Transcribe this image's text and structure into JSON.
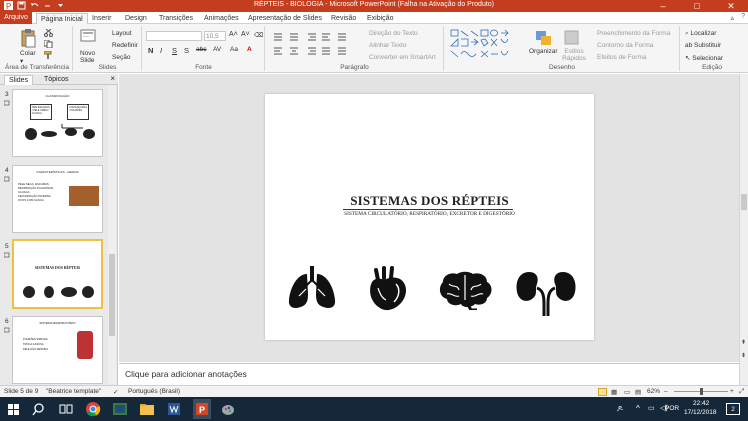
{
  "window": {
    "title": "RÉPTEIS - BIOLOGIA  -  Microsoft PowerPoint (Falha na Ativação do Produto)"
  },
  "ribbon_tabs": [
    "Arquivo",
    "Página Inicial",
    "Inserir",
    "Design",
    "Transições",
    "Animações",
    "Apresentação de Slides",
    "Revisão",
    "Exibição"
  ],
  "ribbon": {
    "clipboard": {
      "paste": "Colar",
      "group": "Área de Transferência"
    },
    "slides": {
      "new_slide": "Novo Slide",
      "layout": "Layout",
      "reset": "Redefinir",
      "section": "Seção",
      "group": "Slides"
    },
    "font": {
      "size": "10,5",
      "bold": "N",
      "italic": "I",
      "underline": "S",
      "shadow": "S",
      "strike": "abc",
      "spacing": "AV",
      "case": "Aa",
      "group": "Fonte"
    },
    "paragraph": {
      "text_direction": "Direção do Texto",
      "align_text": "Alinhar Texto",
      "smartart": "Converter em SmartArt",
      "group": "Parágrafo"
    },
    "drawing": {
      "arrange": "Organizar",
      "quick_styles": "Estilos Rápidos",
      "fill": "Preenchimento da Forma",
      "outline": "Contorno da Forma",
      "effects": "Efeitos de Forma",
      "group": "Desenho"
    },
    "editing": {
      "find": "Localizar",
      "replace": "Substituir",
      "select": "Selecionar",
      "group": "Edição"
    }
  },
  "slide_pane": {
    "tabs": [
      "Slides",
      "Tópicos"
    ],
    "thumbnails": [
      {
        "number": "3",
        "title": "CLASSIFICAÇÃO",
        "box1": "SEM ESCAMAS / PELE ÚMIDA / CLOACA",
        "box2": "COM ESCAMAS / PULMÕES",
        "selected": false
      },
      {
        "number": "4",
        "title": "CARACTERÍSTICAS - GERAIS",
        "lines": [
          "PELE SECA, ESCAMAS",
          "RESPIRAÇÃO PULMONAR",
          "CLOACA",
          "FECUNDAÇÃO INTERNA",
          "OVOS COM CASCA"
        ],
        "selected": false
      },
      {
        "number": "5",
        "title": "SISTEMAS DOS RÉPTEIS",
        "selected": true
      },
      {
        "number": "6",
        "title": "SISTEMA RESPIRATÓRIO",
        "lines": [
          "PULMÕES SIMPLES",
          "TROCA GASOSA",
          "PELE NÃO RESPIRA"
        ],
        "selected": false
      }
    ]
  },
  "slide": {
    "title": "SISTEMAS DOS RÉPTEIS",
    "subtitle": "SISTEMA CIRCULATÓRIO,  RESPIRATÓRIO,  EXCRETOR E DIGESTÓRIO",
    "icons": [
      "lungs-icon",
      "heart-icon",
      "brain-icon",
      "kidneys-icon"
    ]
  },
  "notes": {
    "placeholder": "Clique para adicionar anotações"
  },
  "status": {
    "slide_info": "Slide 5 de 9",
    "theme": "\"Beatrice template\"",
    "language": "Português (Brasil)",
    "zoom": "62%"
  },
  "taskbar": {
    "lang": "POR",
    "time": "22:42",
    "date": "17/12/2018",
    "notif": "2"
  },
  "colors": {
    "accent": "#c43d1e",
    "taskbar": "#15283a",
    "selected_thumb": "#f0c040"
  }
}
